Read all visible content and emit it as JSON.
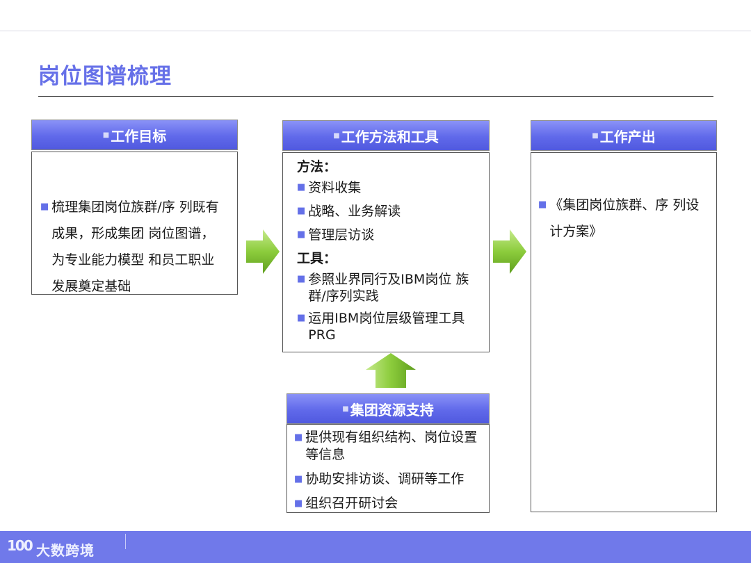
{
  "page": {
    "title": "岗位图谱梳理"
  },
  "goal": {
    "header": "工作目标",
    "text": "梳理集团岗位族群/序 列既有成果，形成集团 岗位图谱，为专业能力模型 和员工职业发展奠定基础"
  },
  "method": {
    "header": "工作方法和工具",
    "methods_label": "方法：",
    "methods": [
      "资料收集",
      "战略、业务解读",
      "管理层访谈"
    ],
    "tools_label": "工具：",
    "tools": [
      "参照业界同行及IBM岗位 族群/序列实践",
      "运用IBM岗位层级管理工具PRG"
    ]
  },
  "output": {
    "header": "工作产出",
    "text": "《集团岗位族群、序 列设计方案》"
  },
  "support": {
    "header": "集团资源支持",
    "items": [
      "提供现有组织结构、岗位设置等信息",
      "协助安排访谈、调研等工作",
      "组织召开研讨会"
    ]
  },
  "footer": {
    "logo_mark": "100",
    "logo_text": "大数跨境"
  },
  "colors": {
    "accent": "#6670e8",
    "header": "#6069ea",
    "arrow": "#8ccc3c",
    "footer": "#7079ea"
  },
  "icons": {
    "bullet": "square-bullet",
    "flow_arrow": "green-block-arrow"
  }
}
